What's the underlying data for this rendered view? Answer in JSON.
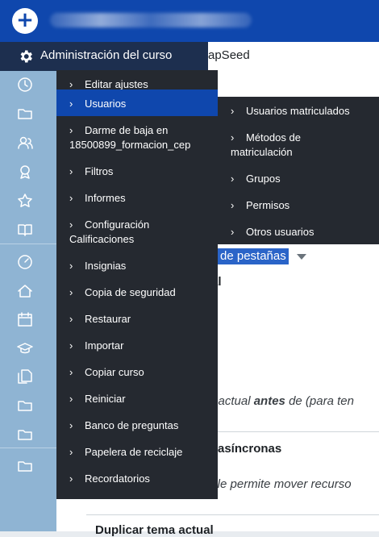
{
  "topbar": {
    "add_icon": "plus-circle-icon",
    "title_blurred": true
  },
  "admin_header": {
    "label": "Administración del curso",
    "icon": "gear-icon"
  },
  "background": {
    "partial_title": "apSeed",
    "tab_dropdown": "de pestañas",
    "partial_l": "al",
    "line_antes_pre": "a actual ",
    "line_antes_bold": "antes",
    "line_antes_post": " de (para ten",
    "heading_asincronas": "asíncronas",
    "line_mover": "s le permite mover recurso",
    "heading_duplicar": "Duplicar tema actual"
  },
  "menu1": [
    {
      "label": "Editar ajustes"
    },
    {
      "label": "Usuarios",
      "active": true
    },
    {
      "label": "Darme de baja en",
      "label2": "18500899_formacion_cep"
    },
    {
      "label": "Filtros"
    },
    {
      "label": "Informes"
    },
    {
      "label": "Configuración",
      "label2": "Calificaciones"
    },
    {
      "label": "Insignias"
    },
    {
      "label": "Copia de seguridad"
    },
    {
      "label": "Restaurar"
    },
    {
      "label": "Importar"
    },
    {
      "label": "Copiar curso"
    },
    {
      "label": "Reiniciar"
    },
    {
      "label": "Banco de preguntas"
    },
    {
      "label": "Papelera de reciclaje"
    },
    {
      "label": "Recordatorios"
    }
  ],
  "menu2": [
    {
      "label": "Usuarios matriculados"
    },
    {
      "label": "Métodos de",
      "label2": "matriculación"
    },
    {
      "label": "Grupos"
    },
    {
      "label": "Permisos"
    },
    {
      "label": "Otros usuarios"
    }
  ],
  "rail_icons": [
    "clock-icon",
    "folder-icon",
    "users-icon",
    "award-icon",
    "star-icon",
    "book-icon",
    "dashboard-icon",
    "home-icon",
    "calendar-icon",
    "graduation-cap-icon",
    "files-icon",
    "folder-icon",
    "folder-icon",
    "folder-icon"
  ]
}
